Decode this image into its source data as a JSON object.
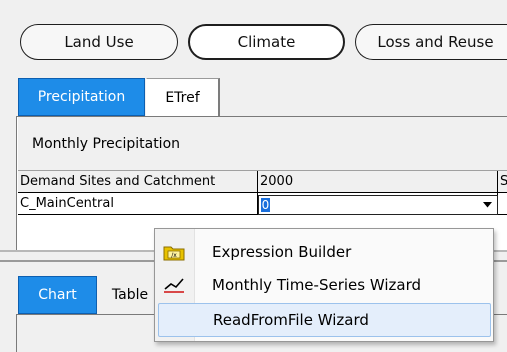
{
  "top_buttons": [
    {
      "label": "Land Use"
    },
    {
      "label": "Climate"
    },
    {
      "label": "Loss and Reuse"
    }
  ],
  "tabs": [
    {
      "label": "Precipitation",
      "selected": true
    },
    {
      "label": "ETref",
      "selected": false
    }
  ],
  "grid": {
    "caption": "Monthly Precipitation",
    "columns": [
      "Demand Sites and Catchment",
      "2000",
      "S"
    ],
    "rows": [
      {
        "name": "C_MainCentral",
        "value": "0"
      }
    ]
  },
  "bottom_tabs": [
    {
      "label": "Chart",
      "selected": true
    },
    {
      "label": "Table",
      "selected": false
    }
  ],
  "context_menu": {
    "items": [
      {
        "label": "Expression Builder",
        "icon": "expression-builder-icon"
      },
      {
        "label": "Monthly Time-Series Wizard",
        "icon": "time-series-icon"
      },
      {
        "label": "ReadFromFile Wizard",
        "icon": "",
        "highlighted": true
      }
    ]
  },
  "colors": {
    "selected_tab": "#1e8ce8",
    "menu_hover": "#e4eefb"
  }
}
